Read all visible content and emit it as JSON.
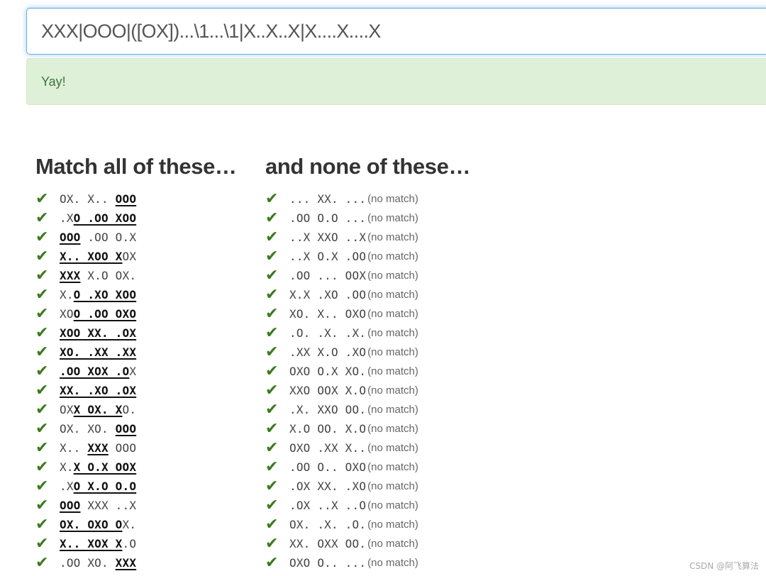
{
  "regex": {
    "value": "XXX|OOO|([OX])...\\1...\\1|X..X..X|X....X....X"
  },
  "alert": {
    "text": "Yay!"
  },
  "match_column": {
    "heading": "Match all of these…",
    "rows": [
      [
        {
          "t": "OX. X.. ",
          "m": false
        },
        {
          "t": "OOO",
          "m": true
        }
      ],
      [
        {
          "t": ".X",
          "m": false
        },
        {
          "t": "O .OO XOO",
          "m": true
        }
      ],
      [
        {
          "t": "OOO",
          "m": true
        },
        {
          "t": " .OO O.X",
          "m": false
        }
      ],
      [
        {
          "t": "X.. XOO X",
          "m": true
        },
        {
          "t": "OX",
          "m": false
        }
      ],
      [
        {
          "t": "XXX",
          "m": true
        },
        {
          "t": " X.O OX.",
          "m": false
        }
      ],
      [
        {
          "t": "X.",
          "m": false
        },
        {
          "t": "O .XO XOO",
          "m": true
        }
      ],
      [
        {
          "t": "XO",
          "m": false
        },
        {
          "t": "O .OO OXO",
          "m": true
        }
      ],
      [
        {
          "t": "XOO XX. .OX",
          "m": true
        }
      ],
      [
        {
          "t": "XO. .XX .XX",
          "m": true
        }
      ],
      [
        {
          "t": ".OO XOX .O",
          "m": true
        },
        {
          "t": "X",
          "m": false
        }
      ],
      [
        {
          "t": "XX. .XO .OX",
          "m": true
        }
      ],
      [
        {
          "t": "OX",
          "m": false
        },
        {
          "t": "X OX. X",
          "m": true
        },
        {
          "t": "O.",
          "m": false
        }
      ],
      [
        {
          "t": "OX. XO. ",
          "m": false
        },
        {
          "t": "OOO",
          "m": true
        }
      ],
      [
        {
          "t": "X.. ",
          "m": false
        },
        {
          "t": "XXX",
          "m": true
        },
        {
          "t": " OOO",
          "m": false
        }
      ],
      [
        {
          "t": "X.",
          "m": false
        },
        {
          "t": "X O.X OOX",
          "m": true
        }
      ],
      [
        {
          "t": ".X",
          "m": false
        },
        {
          "t": "O X.O O.O",
          "m": true
        }
      ],
      [
        {
          "t": "OOO",
          "m": true
        },
        {
          "t": " XXX ..X",
          "m": false
        }
      ],
      [
        {
          "t": "OX. OXO O",
          "m": true
        },
        {
          "t": "X.",
          "m": false
        }
      ],
      [
        {
          "t": "X.. XOX X",
          "m": true
        },
        {
          "t": ".O",
          "m": false
        }
      ],
      [
        {
          "t": ".OO XO. ",
          "m": false
        },
        {
          "t": "XXX",
          "m": true
        }
      ]
    ]
  },
  "nomatch_column": {
    "heading": "and none of these…",
    "suffix": "(no match)",
    "rows": [
      "... XX. ...",
      ".OO O.O ...",
      "..X XXO ..X",
      "..X O.X .OO",
      ".OO ... OOX",
      "X.X .XO .OO",
      "XO. X.. OXO",
      ".O. .X. .X.",
      ".XX X.O .XO",
      "OXO O.X XO.",
      "XXO OOX X.O",
      ".X. XXO OO.",
      "X.O OO. X.O",
      "OXO .XX X..",
      ".OO O.. OXO",
      ".OX XX. .XO",
      ".OX ..X ..O",
      "OX. .X. .O.",
      "XX. OXX OO.",
      "OXO O.. ..."
    ]
  },
  "check_glyph": "✔",
  "watermark": "CSDN @阿飞算法",
  "colors": {
    "check": "#3c7a1e",
    "alert_bg": "#dff0d8",
    "alert_text": "#3c763d",
    "focus_border": "#66afe9"
  }
}
